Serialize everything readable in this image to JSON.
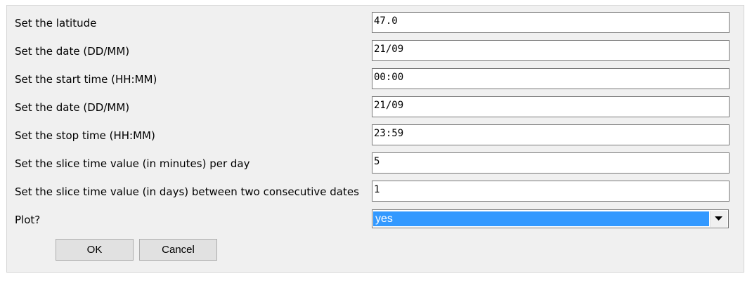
{
  "form": {
    "fields": [
      {
        "label": "Set the latitude",
        "value": "47.0"
      },
      {
        "label": "Set the date (DD/MM)",
        "value": "21/09"
      },
      {
        "label": "Set the start time (HH:MM)",
        "value": "00:00"
      },
      {
        "label": "Set the date (DD/MM)",
        "value": "21/09"
      },
      {
        "label": "Set the stop time (HH:MM)",
        "value": "23:59"
      },
      {
        "label": "Set the slice time value (in minutes) per day",
        "value": "5"
      },
      {
        "label": "Set the slice time value (in days) between two consecutive dates",
        "value": "1"
      }
    ],
    "plot": {
      "label": "Plot?",
      "selected": "yes"
    }
  },
  "buttons": {
    "ok": "OK",
    "cancel": "Cancel"
  },
  "colors": {
    "panel_bg": "#f0f0f0",
    "selection": "#3399ff",
    "button_bg": "#e1e1e1"
  }
}
